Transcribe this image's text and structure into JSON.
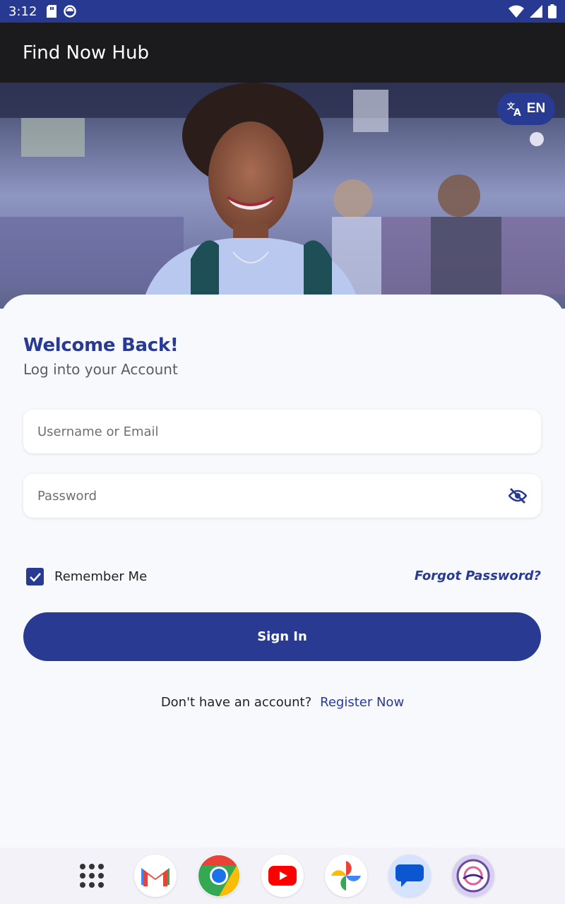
{
  "status_bar": {
    "time": "3:12"
  },
  "app_bar": {
    "title": "Find Now Hub"
  },
  "language": {
    "code": "EN",
    "icon": "translate-icon"
  },
  "login": {
    "heading": "Welcome Back!",
    "subheading": "Log into your Account",
    "username_placeholder": "Username or Email",
    "password_placeholder": "Password",
    "remember_label": "Remember Me",
    "remember_checked": true,
    "forgot_label": "Forgot Password?",
    "signin_label": "Sign In",
    "no_account_text": "Don't have an account?",
    "register_label": "Register Now"
  },
  "dock": {
    "apps": [
      "app-drawer",
      "gmail",
      "chrome",
      "youtube",
      "photos",
      "messages",
      "findnow"
    ]
  },
  "colors": {
    "primary": "#283a92",
    "status_bar": "#273990",
    "app_bar": "#1b1a1d",
    "background": "#f8f9fc"
  }
}
